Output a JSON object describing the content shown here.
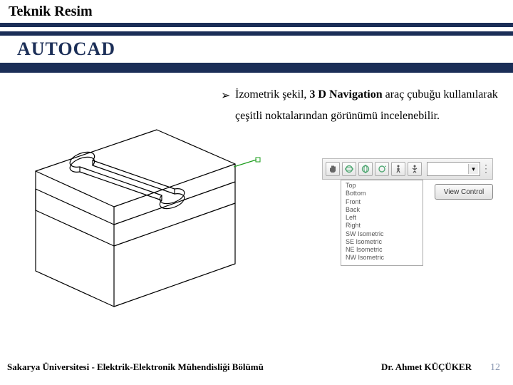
{
  "header": {
    "title": "Teknik Resim",
    "subtitle": "AUTOCAD"
  },
  "bullet": {
    "prefix": "İzometrik şekil, ",
    "bold": "3 D Navigation",
    "suffix": " araç çubuğu kullanılarak çeşitli noktalarından görünümü incelenebilir."
  },
  "toolbar": {
    "icons": [
      "hand-icon",
      "orbit-icon",
      "orbit-free-icon",
      "orbit-cont-icon",
      "walk-icon",
      "fly-icon"
    ]
  },
  "viewlist": {
    "items": [
      "Top",
      "Bottom",
      "Front",
      "Back",
      "Left",
      "Right",
      "SW Isometric",
      "SE Isometric",
      "NE Isometric",
      "NW Isometric"
    ]
  },
  "viewcontrol": {
    "label": "View Control"
  },
  "footer": {
    "university": "Sakarya Üniversitesi - Elektrik-Elektronik Mühendisliği Bölümü",
    "author": "Dr. Ahmet KÜÇÜKER",
    "page": "12"
  }
}
